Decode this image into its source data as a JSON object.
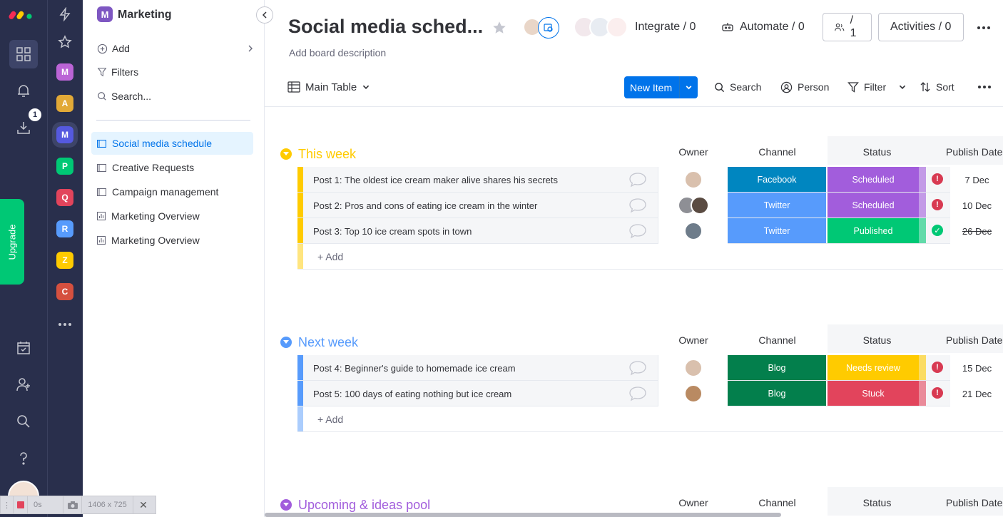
{
  "colors": {
    "accent": "#0073ea",
    "rail": "#292f4c",
    "yellow": "#ffcb00",
    "blue": "#579bfc",
    "purple": "#a25ddc",
    "facebook": "#0086c0",
    "twitter": "#579bfc",
    "blog": "#037f4c",
    "scheduled": "#a25ddc",
    "published": "#00c875",
    "needs_review": "#ffcb00",
    "stuck": "#e2445c"
  },
  "rail": {
    "notifications_badge": "1",
    "upgrade_label": "Upgrade"
  },
  "workspaces": [
    "M",
    "A",
    "M",
    "P",
    "Q",
    "R",
    "Z",
    "C"
  ],
  "sidebar": {
    "workspace_name": "Marketing",
    "workspace_initial": "M",
    "actions": [
      {
        "label": "Add"
      },
      {
        "label": "Filters"
      },
      {
        "label": "Search..."
      }
    ],
    "boards": [
      {
        "label": "Social media schedule",
        "icon": "board-icon"
      },
      {
        "label": "Creative Requests",
        "icon": "board-icon"
      },
      {
        "label": "Campaign management",
        "icon": "board-icon"
      },
      {
        "label": "Marketing Overview",
        "icon": "dashboard-icon"
      },
      {
        "label": "Marketing Overview",
        "icon": "dashboard-icon"
      }
    ]
  },
  "board": {
    "title": "Social media sched...",
    "description": "Add board description",
    "integrate": "Integrate / 0",
    "automate": "Automate / 0",
    "members": "/ 1",
    "activities": "Activities / 0"
  },
  "toolbar": {
    "view": "Main Table",
    "new_item": "New Item",
    "search": "Search",
    "person": "Person",
    "filter": "Filter",
    "sort": "Sort"
  },
  "columns": {
    "owner": "Owner",
    "channel": "Channel",
    "status": "Status",
    "publish_date": "Publish Date"
  },
  "groups": [
    {
      "title": "This week",
      "color": "#ffcb00",
      "add_label": "+ Add",
      "items": [
        {
          "name": "Post 1: The oldest ice cream maker alive shares his secrets",
          "channel": "Facebook",
          "channel_color": "#0086c0",
          "status": "Scheduled",
          "status_color": "#a25ddc",
          "date": "7 Dec",
          "date_state": "alert"
        },
        {
          "name": "Post 2: Pros and cons of eating ice cream in the winter",
          "channel": "Twitter",
          "channel_color": "#579bfc",
          "status": "Scheduled",
          "status_color": "#a25ddc",
          "date": "10 Dec",
          "date_state": "alert"
        },
        {
          "name": "Post 3: Top 10 ice cream spots in town",
          "channel": "Twitter",
          "channel_color": "#579bfc",
          "status": "Published",
          "status_color": "#00c875",
          "date": "26 Dec",
          "date_state": "done"
        }
      ]
    },
    {
      "title": "Next week",
      "color": "#579bfc",
      "add_label": "+ Add",
      "items": [
        {
          "name": "Post 4: Beginner's guide to homemade ice cream",
          "channel": "Blog",
          "channel_color": "#037f4c",
          "status": "Needs review",
          "status_color": "#ffcb00",
          "date": "15 Dec",
          "date_state": "alert"
        },
        {
          "name": "Post 5: 100 days of eating nothing but ice cream",
          "channel": "Blog",
          "channel_color": "#037f4c",
          "status": "Stuck",
          "status_color": "#e2445c",
          "date": "21 Dec",
          "date_state": "alert"
        }
      ]
    },
    {
      "title": "Upcoming & ideas pool",
      "color": "#a25ddc",
      "add_label": "+ Add",
      "items": []
    }
  ],
  "recorder": {
    "time": "0s",
    "size": "1406 x 725"
  }
}
